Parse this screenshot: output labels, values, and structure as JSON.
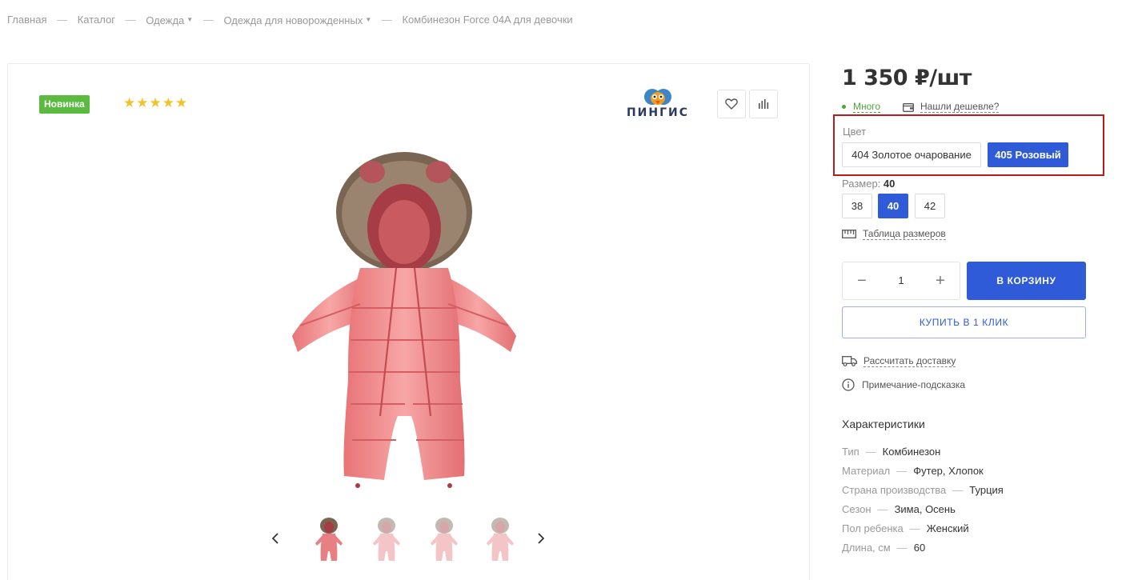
{
  "breadcrumb": {
    "items": [
      "Главная",
      "Каталог",
      "Одежда",
      "Одежда для новорожденных",
      "Комбинезон Force 04A для девочки"
    ],
    "separator": "—"
  },
  "gallery": {
    "badge": "Новинка",
    "stars": "★★★★★",
    "brand_name": "ПИНГИС",
    "thumb_count": 4
  },
  "product": {
    "price": "1 350 ₽/шт",
    "stock": "Много",
    "cheaper": "Нашли дешевле?"
  },
  "color": {
    "title": "Цвет",
    "options": [
      "404 Золотое очарование",
      "405 Розовый"
    ],
    "selected": "405 Розовый"
  },
  "size": {
    "title": "Размер:",
    "current": "40",
    "options": [
      "38",
      "40",
      "42"
    ],
    "table_link": "Таблица размеров"
  },
  "purchase": {
    "quantity": "1",
    "minus": "−",
    "plus": "+",
    "cart_button": "В КОРЗИНУ",
    "one_click_button": "КУПИТЬ В 1 КЛИК"
  },
  "links": {
    "delivery": "Рассчитать доставку",
    "hint": "Примечание-подсказка"
  },
  "specs": {
    "title": "Характеристики",
    "separator": "—",
    "rows": [
      {
        "name": "Тип",
        "value": "Комбинезон"
      },
      {
        "name": "Материал",
        "value": "Футер, Хлопок"
      },
      {
        "name": "Страна производства",
        "value": "Турция"
      },
      {
        "name": "Сезон",
        "value": "Зима, Осень"
      },
      {
        "name": "Пол ребенка",
        "value": "Женский"
      },
      {
        "name": "Длина, см",
        "value": "60"
      }
    ]
  },
  "colors": {
    "accent": "#2f5bd9",
    "badge_green": "#5bbb40",
    "stock_green": "#4aa736",
    "highlight_red": "#b71c1c",
    "star": "#f0c32e",
    "product_pink": "#f08a8c"
  }
}
